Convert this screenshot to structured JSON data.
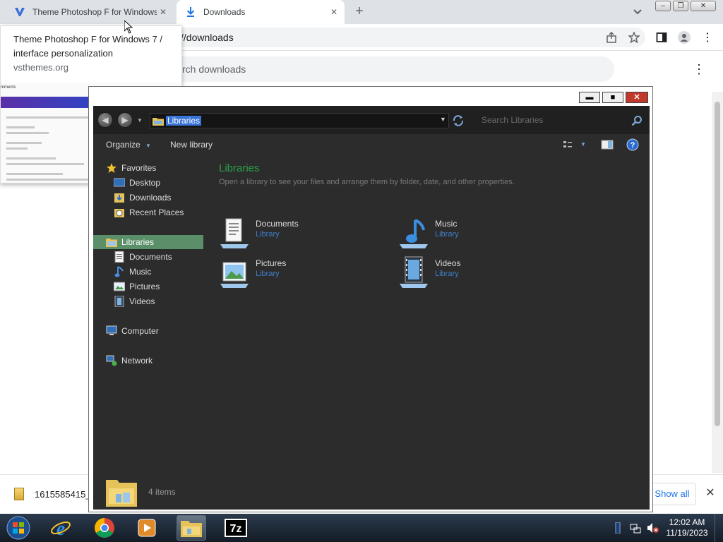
{
  "browser": {
    "tabs": [
      {
        "label": "Theme Photoshop F for Windows 7 / interface personalization",
        "icon": "vsthemes-logo-icon"
      },
      {
        "label": "Downloads",
        "icon": "download-icon"
      }
    ],
    "new_tab_label": "+",
    "address_text": "//downloads",
    "search_placeholder": "rch downloads",
    "menu_icon": "⋮"
  },
  "hover_card": {
    "title": "Theme Photoshop F for Windows 7 / interface personalization",
    "domain": "vsthemes.org",
    "preview_heading": "mments"
  },
  "download_shelf": {
    "filename": "1615585415_",
    "show_all_label": "Show all",
    "close_label": "✕"
  },
  "explorer": {
    "window_controls": {
      "minimize": "▬",
      "maximize": "■",
      "close": "✕"
    },
    "address": "Libraries",
    "search_placeholder": "Search Libraries",
    "commands": {
      "organize": "Organize",
      "new_library": "New library"
    },
    "nav": {
      "favorites": "Favorites",
      "desktop": "Desktop",
      "downloads": "Downloads",
      "recent_places": "Recent Places",
      "libraries": "Libraries",
      "documents": "Documents",
      "music": "Music",
      "pictures": "Pictures",
      "videos": "Videos",
      "computer": "Computer",
      "network": "Network"
    },
    "content": {
      "title": "Libraries",
      "description": "Open a library to see your files and arrange them by folder, date, and other properties.",
      "items": [
        {
          "name": "Documents",
          "type": "Library",
          "icon": "documents-library-icon"
        },
        {
          "name": "Music",
          "type": "Library",
          "icon": "music-library-icon"
        },
        {
          "name": "Pictures",
          "type": "Library",
          "icon": "pictures-library-icon"
        },
        {
          "name": "Videos",
          "type": "Library",
          "icon": "videos-library-icon"
        }
      ]
    },
    "status": "4 items"
  },
  "taskbar": {
    "apps": [
      "start-orb-icon",
      "internet-explorer-icon",
      "chrome-icon",
      "media-player-icon",
      "file-explorer-icon",
      "7zip-icon"
    ],
    "time": "12:02 AM",
    "date": "11/19/2023"
  },
  "colors": {
    "accent_blue": "#3874d8",
    "library_title_green": "#2aa34a",
    "nav_selected": "#5a8f6a",
    "explorer_bg": "#2c2c2c"
  }
}
